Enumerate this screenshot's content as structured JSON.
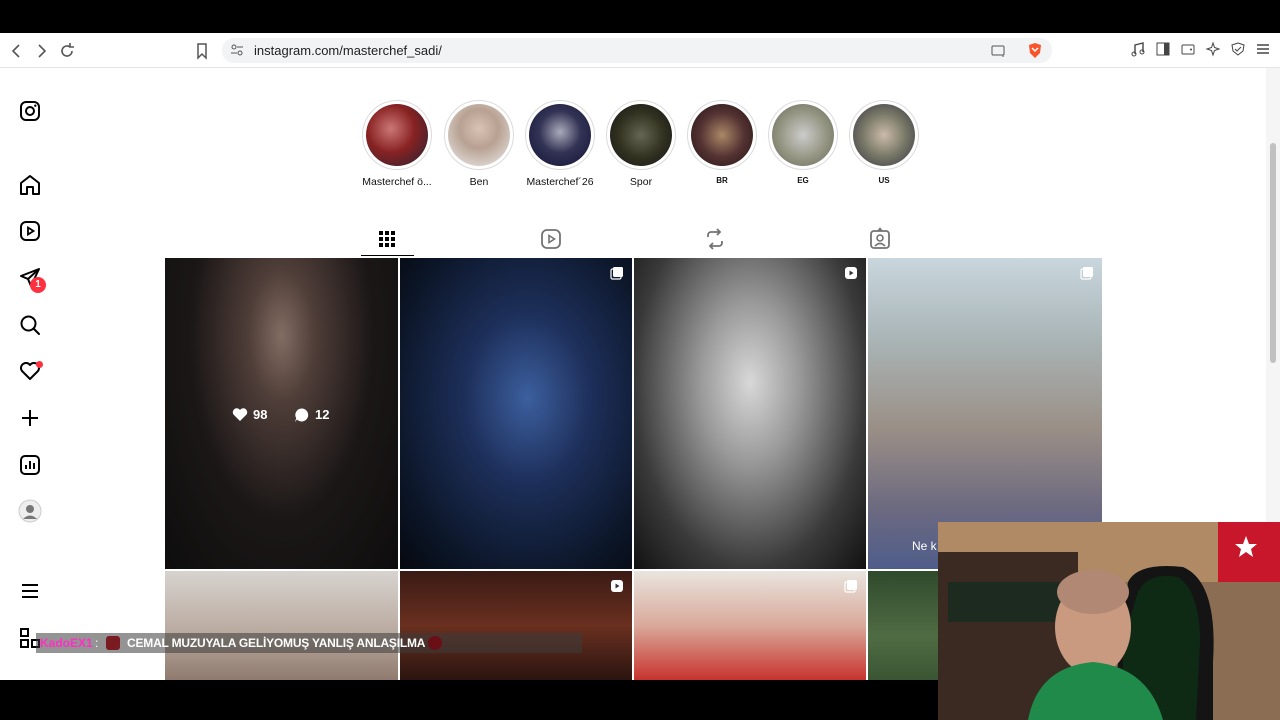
{
  "browser": {
    "url": "instagram.com/masterchef_sadi/"
  },
  "sidebar": {
    "messages_badge": "1"
  },
  "highlights": [
    {
      "label": "Masterchef ö..."
    },
    {
      "label": "Ben"
    },
    {
      "label": "Masterchef´26"
    },
    {
      "label": "Spor"
    },
    {
      "label": "BR"
    },
    {
      "label": "EG"
    },
    {
      "label": "US"
    }
  ],
  "tabs": [
    {
      "name": "posts-grid-icon",
      "active": true
    },
    {
      "name": "reels-icon",
      "active": false
    },
    {
      "name": "reposts-icon",
      "active": false
    },
    {
      "name": "tagged-icon",
      "active": false
    }
  ],
  "posts": [
    {
      "likes": "98",
      "comments": "12",
      "hovered": true
    }
  ],
  "webcam_overlay": {
    "partial_caption": "Ne k"
  },
  "chat": {
    "username": "KadoEX1",
    "separator": ":",
    "message": "CEMAL MUZUYALA GELİYOMUŞ YANLIŞ ANLAŞILMA"
  },
  "colors": {
    "badge": "#ff3040",
    "chat_username": "#ff2ec4"
  }
}
